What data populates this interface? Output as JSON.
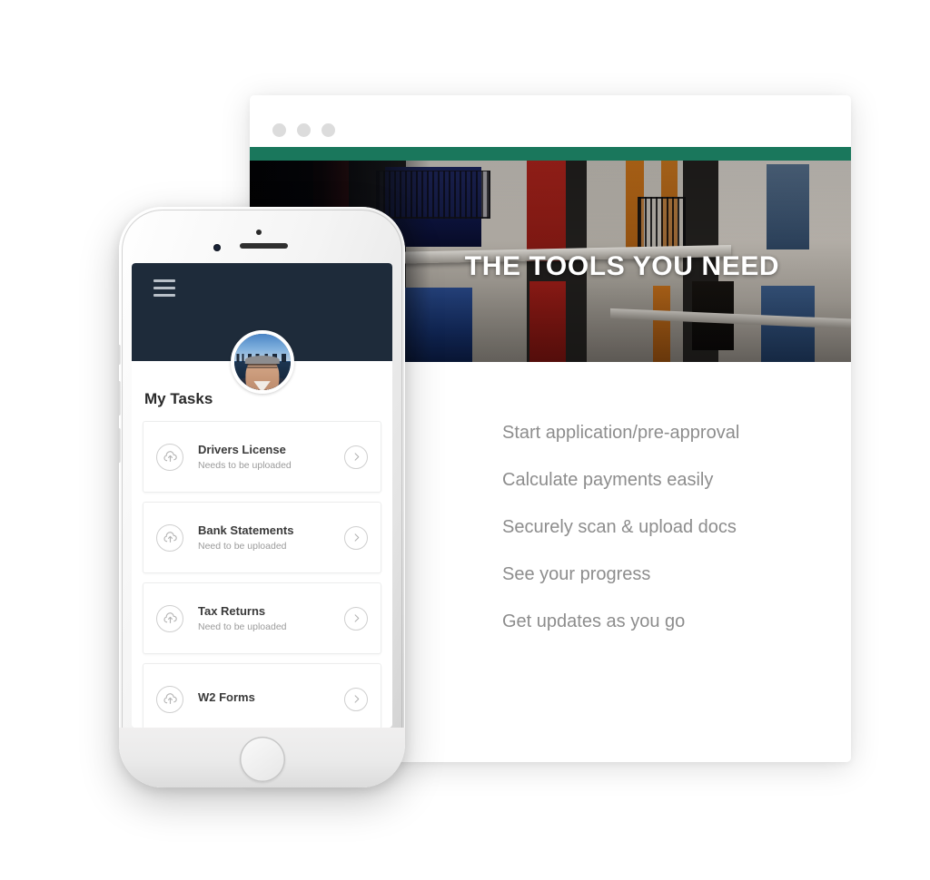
{
  "browser": {
    "traffic_lights": [
      "dot-1",
      "dot-2",
      "dot-3"
    ],
    "accent_bar_color": "#1a775c",
    "hero": {
      "title": "THE TOOLS YOU NEED",
      "image_description": "colorful european building facade with red and orange shutters"
    },
    "features": [
      "Start application/pre-approval",
      "Calculate payments easily",
      "Securely scan & upload docs",
      "See your progress",
      "Get updates as you go"
    ]
  },
  "phone": {
    "header": {
      "menu_icon": "hamburger-icon",
      "background_color": "#1e2b3a"
    },
    "avatar": {
      "alt": "user profile photo with city skyline background"
    },
    "section_title": "My Tasks",
    "tasks": [
      {
        "title": "Drivers License",
        "status": "Needs to be uploaded",
        "upload_icon": "cloud-upload-icon",
        "action_icon": "chevron-right-icon"
      },
      {
        "title": "Bank Statements",
        "status": "Need to be uploaded",
        "upload_icon": "cloud-upload-icon",
        "action_icon": "chevron-right-icon"
      },
      {
        "title": "Tax Returns",
        "status": "Need to be uploaded",
        "upload_icon": "cloud-upload-icon",
        "action_icon": "chevron-right-icon"
      },
      {
        "title": "W2 Forms",
        "status": "",
        "upload_icon": "cloud-upload-icon",
        "action_icon": "chevron-right-icon"
      }
    ],
    "home_button": "home-button"
  }
}
